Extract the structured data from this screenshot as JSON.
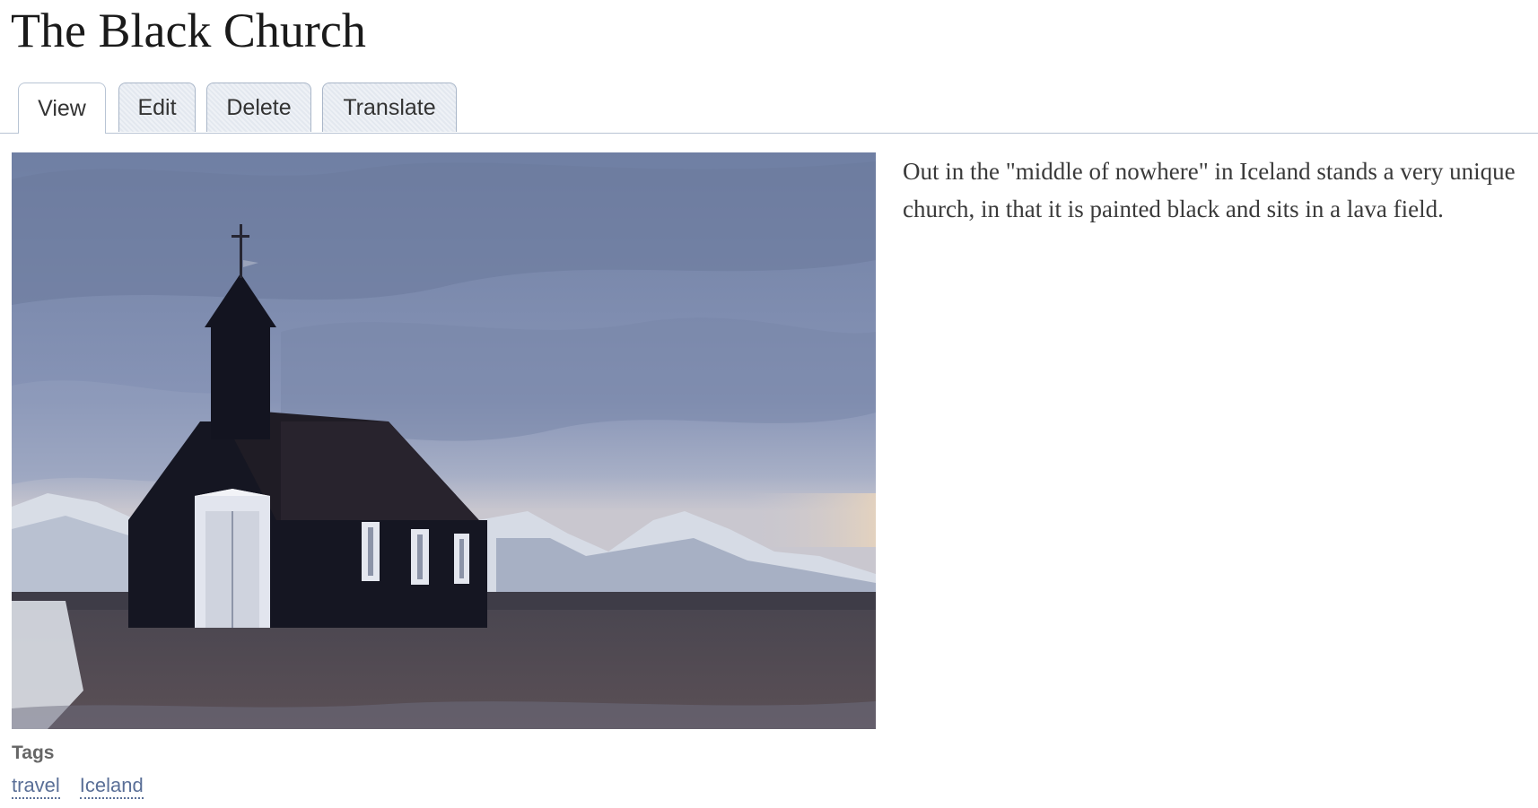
{
  "page": {
    "title": "The Black Church"
  },
  "tabs": [
    {
      "label": "View",
      "active": true
    },
    {
      "label": "Edit",
      "active": false
    },
    {
      "label": "Delete",
      "active": false
    },
    {
      "label": "Translate",
      "active": false
    }
  ],
  "body": {
    "text": "Out in the \"middle of nowhere\" in Iceland stands a very unique church, in that it is painted  black and sits in a lava field."
  },
  "tags": {
    "label": "Tags",
    "items": [
      "travel",
      "Iceland"
    ]
  },
  "colors": {
    "tab_border": "#a9b6c8",
    "tag_link": "#5a6f97",
    "sky": "#7d8db0",
    "church": "#151622"
  }
}
